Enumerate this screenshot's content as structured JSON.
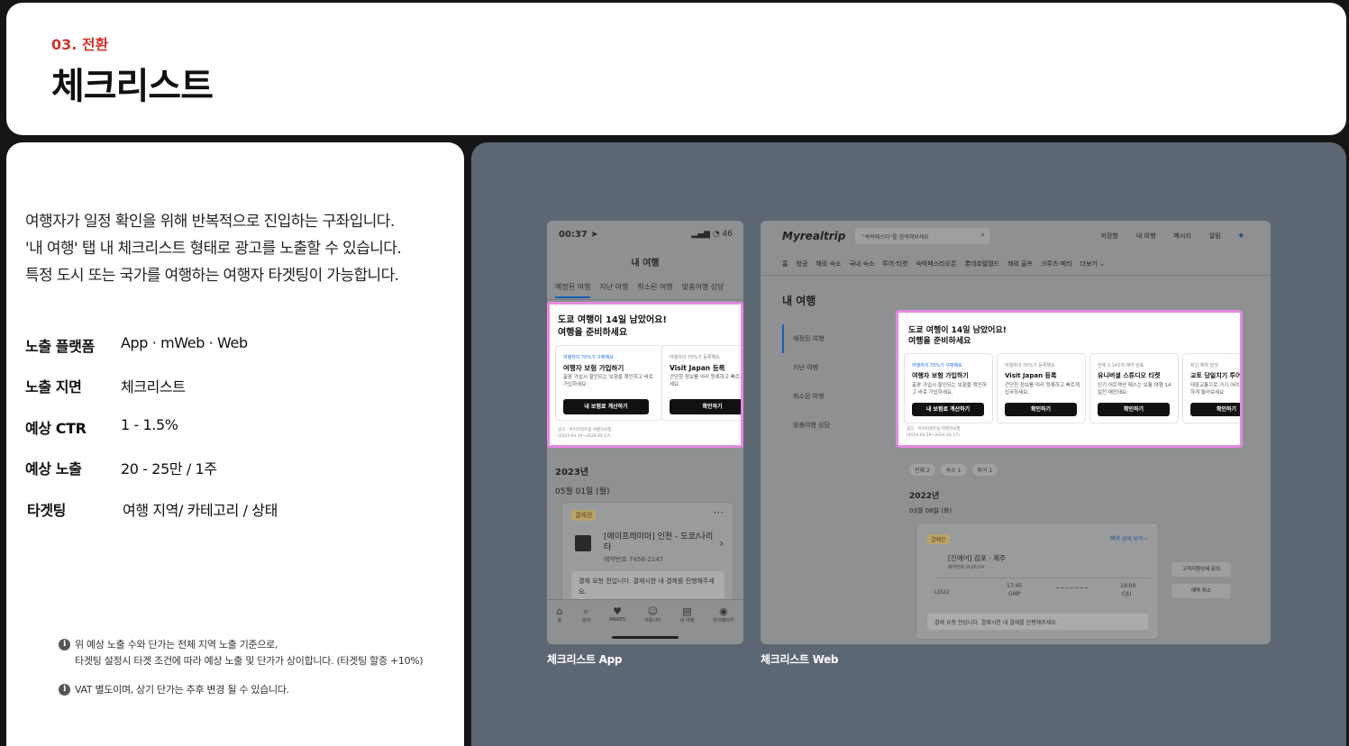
{
  "header": {
    "eyebrow": "03. 전환",
    "title": "체크리스트"
  },
  "info": {
    "description": [
      "여행자가 일정 확인을 위해 반복적으로 진입하는 구좌입니다.",
      "'내 여행' 탭 내 체크리스트 형태로 광고를 노출할 수 있습니다.",
      "특정 도시 또는 국가를 여행하는 여행자 타겟팅이 가능합니다."
    ],
    "specs": [
      {
        "key": "노출 플랫폼",
        "value": "App · mWeb · Web"
      },
      {
        "key": "노출 지면",
        "value": "체크리스트"
      },
      {
        "key": "예상 CTR",
        "value": "1 - 1.5%"
      },
      {
        "key": "예상 노출",
        "value": "20 - 25만 / 1주"
      },
      {
        "key": "타겟팅",
        "value": "여행 지역/ 카테고리 / 상태"
      }
    ],
    "notes": [
      {
        "icon": "i",
        "line1": "위 예상 노출 수와 단가는 전체 지역 노출 기준으로,",
        "line2": "타겟팅 설정시 타겟 조건에 따라 예상 노출 및 단가가 상이합니다. (타겟팅 할증 +10%)"
      },
      {
        "icon": "i",
        "line1": "VAT 별도이며, 상기 단가는 추후 변경 될 수 있습니다.",
        "line2": ""
      }
    ]
  },
  "app": {
    "caption": "체크리스트 App",
    "status_time": "00:37 ➤",
    "status_icons": "▂▄▆ ◔ 46",
    "title": "내 여행",
    "tabs": [
      "예정된 여행",
      "지난 여행",
      "취소된 여행",
      "맞춤여행 상담"
    ],
    "ad": {
      "headline1": "도쿄 여행이 14일 남았어요!",
      "headline2": "여행을 준비하세요",
      "cards": [
        {
          "small": "여행자의 70%가 구매해요",
          "title": "여행자 보험 가입하기",
          "body": "출판 가입시 할인되는 보험을 확인하고 바로 가입하세요.",
          "button": "내 보험료 계산하기"
        },
        {
          "small": "여행자의 70%가 등록해요",
          "title": "Visit Japan 등록",
          "body": "간단한 정보를 미리 등록하고 빠르게 입국하세요.",
          "button": "확인하기"
        }
      ],
      "footer1": "광고 · 마이리얼트립 여행자보험",
      "footer2": "(2024.04.19~2024.04.17)"
    },
    "year": "2023년",
    "date": "05월 01일 (월)",
    "booking": {
      "badge": "결제전",
      "name": "[에이프레미아] 인천 - 도쿄/나리타",
      "number": "예약번호 7456-2147",
      "pay": "결제 요청 전입니다. 결제시한 내 결제를 진행해주세요."
    },
    "nav": [
      {
        "glyph": "⌂",
        "label": "홈"
      },
      {
        "glyph": "⌕",
        "label": "검색"
      },
      {
        "glyph": "♥",
        "label": "RAIKES"
      },
      {
        "glyph": "☺",
        "label": "커뮤니티"
      },
      {
        "glyph": "▤",
        "label": "내 여행"
      },
      {
        "glyph": "◉",
        "label": "마이페이지"
      }
    ]
  },
  "web": {
    "caption": "체크리스트 Web",
    "logo": "Myrealtrip",
    "search_placeholder": "\"숙박페스타\"를 검색해보세요",
    "top_links": [
      "저장함",
      "내 여행",
      "메시지",
      "알림"
    ],
    "menu": [
      "홈",
      "항공",
      "해외 숙소",
      "국내 숙소",
      "투어·티켓",
      "숙박페스타오픈",
      "롯데호텔월드",
      "해외 골프",
      "크루즈·페리",
      "더보기 ⌄"
    ],
    "page_title": "내 여행",
    "side": [
      "예정된 여행",
      "지난 여행",
      "취소된 여행",
      "맞춤여행 상담"
    ],
    "ad": {
      "headline1": "도쿄 여행이 14일 남았어요!",
      "headline2": "여행을 준비하세요",
      "cards": [
        {
          "small": "여행자의 70%가 구매해요",
          "title": "여행자 보험 가입하기",
          "body": "출판 가입시 할인되는 보험을 확인하고 바로 가입하세요.",
          "button": "내 보험료 계산하기"
        },
        {
          "small": "여행자의 70%가 등록해요",
          "title": "Visit Japan 등록",
          "body": "간단한 정보를 미리 등록하고 빠르게 입국하세요.",
          "button": "확인하기"
        },
        {
          "small": "전체 2,143개 예약 완료",
          "title": "유니버셜 스튜디오 티켓",
          "body": "인기 어트랙션 패스는 보통 여행 14일전 매진돼요",
          "button": "확인하기"
        },
        {
          "small": "최근 예약 발생",
          "title": "교토 당일치기 투어",
          "body": "대중교통으로 가기 어려운 명소를 편하게 둘러보세요",
          "button": "확인하기"
        }
      ],
      "footer1": "광고 · 마이리얼트립 여행자보험",
      "footer2": "(2024.04.19~2024.04.17)"
    },
    "chips": [
      "전체 2",
      "숙소 1",
      "투어 1"
    ],
    "year": "2022년",
    "date": "03월 08일 (화)",
    "booking": {
      "badge": "결제전",
      "detail": "예약 상세 보기 ›",
      "name": "[진에어] 김포 - 제주",
      "number": "예약번호 VLDU24",
      "flight_code": "LJ322",
      "dep_time": "17:45",
      "dep_code": "GMP",
      "arr_time": "19:00",
      "arr_code": "CJU",
      "pay": "결제 요청 전입니다. 결제시한 내 결제를 진행해주세요."
    },
    "side_buttons": [
      "고객지원상세 문의",
      "예약 취소"
    ]
  }
}
